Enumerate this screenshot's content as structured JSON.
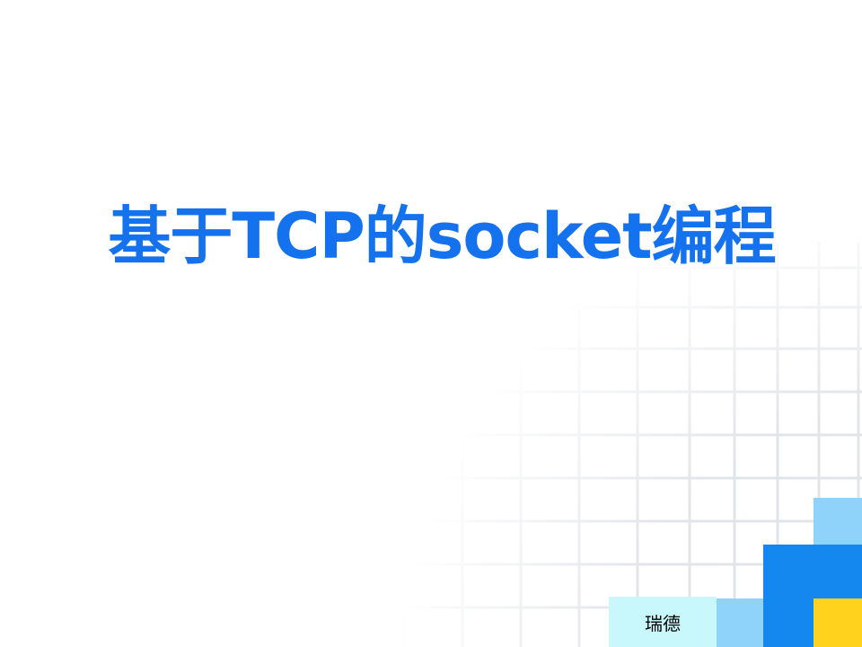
{
  "slide": {
    "title": "基于TCP的socket编程",
    "footer": "瑞德"
  },
  "colors": {
    "title": "#1472ee",
    "grid_line": "#e4e6ea",
    "light_blue": "#8fd3fb",
    "blue": "#1588ef",
    "yellow": "#ffd21e",
    "footer_bg": "#c8f8fb"
  }
}
